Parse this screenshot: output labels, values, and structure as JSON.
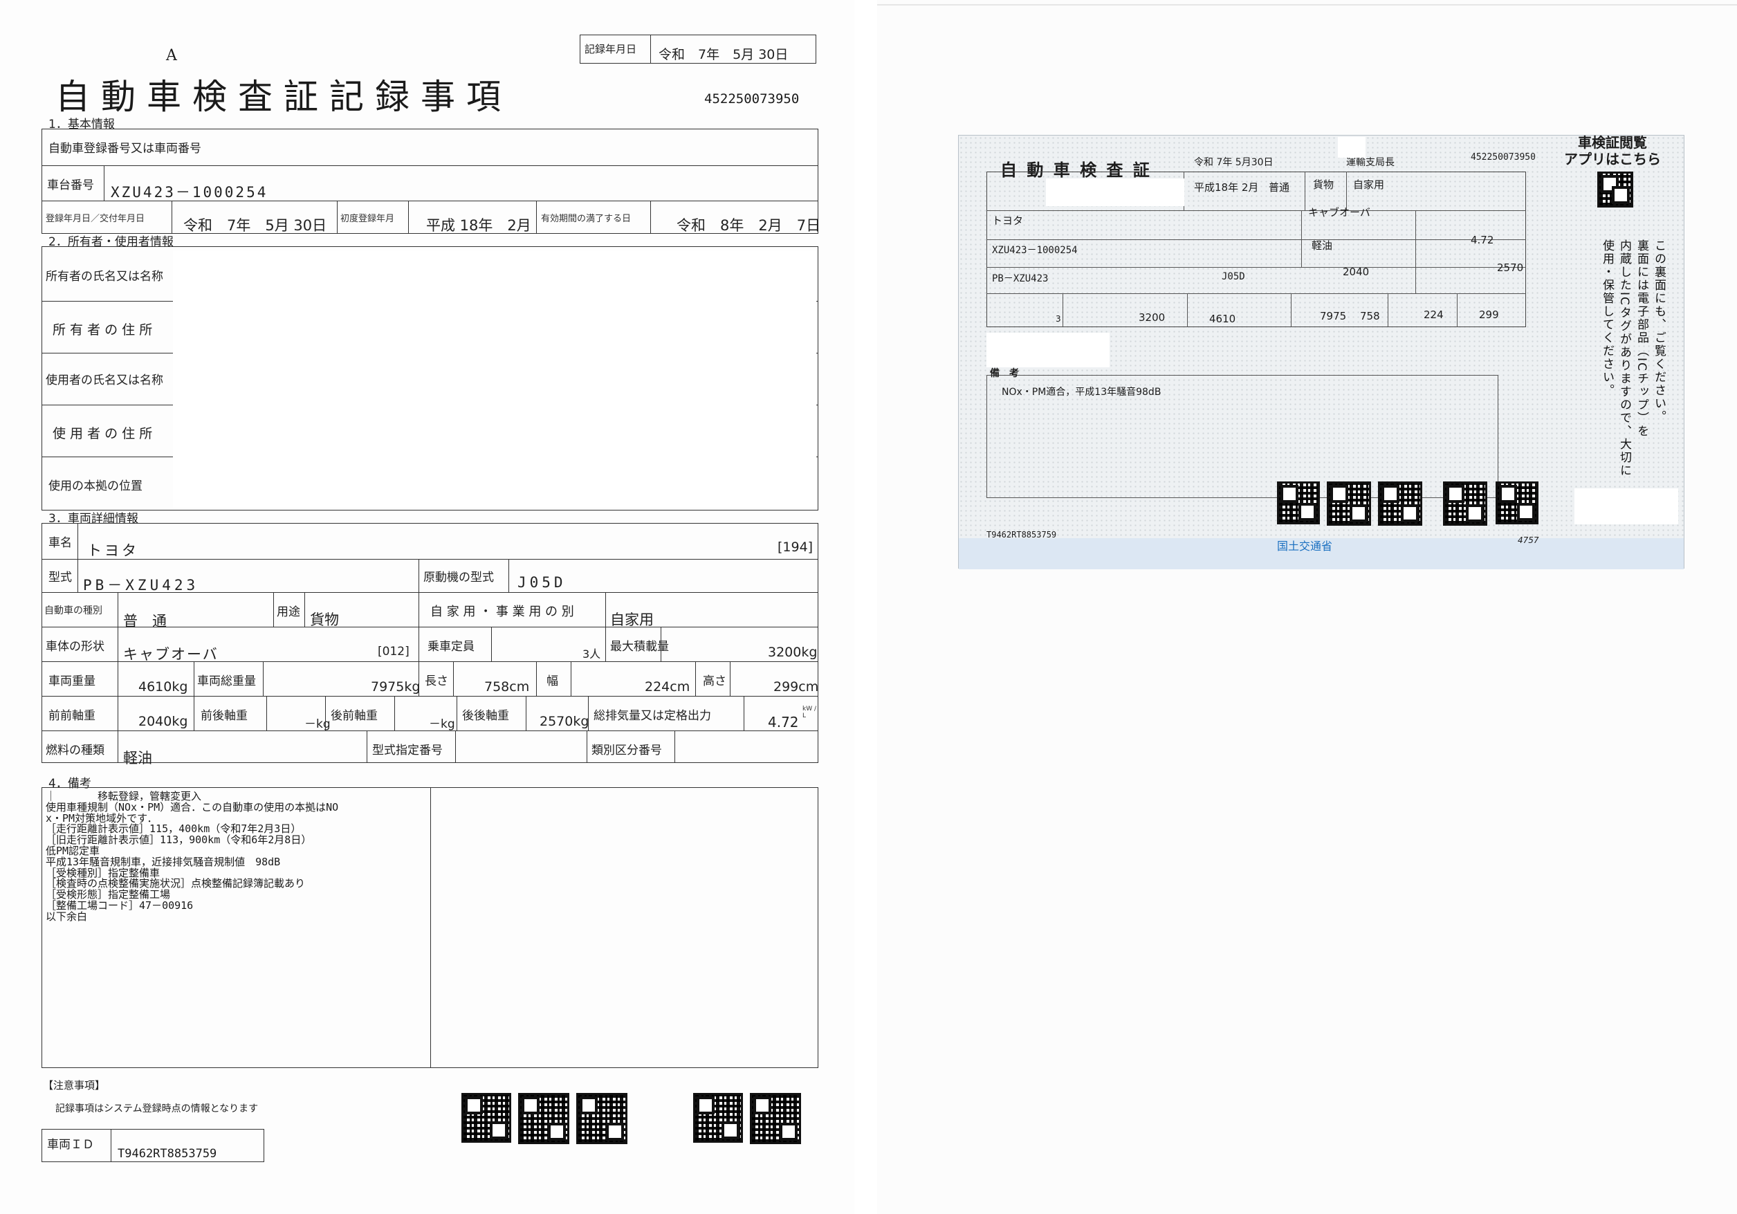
{
  "left": {
    "page_marker": "A",
    "title": "自動車検査証記録事項",
    "record_date_label": "記録年月日",
    "record_date": "令和　7年　5月 30日",
    "doc_number": "452250073950",
    "sections": {
      "basic": "1．基本情報",
      "owner": "2．所有者・使用者情報",
      "vehicle": "3．車両詳細情報",
      "remarks": "4．備考"
    },
    "basic": {
      "reg_label": "自動車登録番号又は車両番号",
      "chassis_label": "車台番号",
      "chassis": "XZU423－1000254",
      "reg_date_label": "登録年月日／交付年月日",
      "reg_date": "令和　7年　5月 30日",
      "first_reg_label": "初度登録年月",
      "first_reg": "平成 18年　2月",
      "expiry_label": "有効期間の満了する日",
      "expiry": "令和　8年　2月　7日"
    },
    "owner": {
      "owner_name": "所有者の氏名又は名称",
      "owner_address": "所 有 者 の 住 所",
      "user_name": "使用者の氏名又は名称",
      "user_address": "使 用 者 の 住 所",
      "base_location": "使用の本拠の位置"
    },
    "vehicle": {
      "name_label": "車名",
      "name": "トヨタ",
      "name_code": "[194]",
      "model_label": "型式",
      "model": "PB－XZU423",
      "engine_label": "原動機の型式",
      "engine": "J05D",
      "kind_label": "自動車の種別",
      "kind": "普　通",
      "use_label": "用途",
      "use": "貨物",
      "private_label": "自 家 用 ・ 事 業 用 の 別",
      "private": "自家用",
      "body_label": "車体の形状",
      "body": "キャブオーバ",
      "body_code": "[012]",
      "capacity_label": "乗車定員",
      "capacity": "3人",
      "max_load_label": "最大積載量",
      "max_load": "3200kg",
      "weight_label": "車両重量",
      "weight": "4610kg",
      "gross_label": "車両総重量",
      "gross": "7975kg",
      "length_label": "長さ",
      "length": "758cm",
      "width_label": "幅",
      "width": "224cm",
      "height_label": "高さ",
      "height": "299cm",
      "ff_label": "前前軸重",
      "ff": "2040kg",
      "fr_label": "前後軸重",
      "fr": "－kg",
      "rf_label": "後前軸重",
      "rf": "－kg",
      "rr_label": "後後軸重",
      "rr": "2570kg",
      "disp_label": "総排気量又は定格出力",
      "disp": "4.72",
      "disp_unit": "kW / L",
      "fuel_label": "燃料の種類",
      "fuel": "軽油",
      "type_no_label": "型式指定番号",
      "class_no_label": "類別区分番号"
    },
    "remarks": [
      "｜　　　　移転登録，管轄変更入",
      "使用車種規制（NOx・PM）適合．この自動車の使用の本拠はNO",
      "x・PM対策地域外です．",
      "［走行距離計表示値］115，400km（令和7年2月3日）",
      "［旧走行距離計表示値］113，900km（令和6年2月8日）",
      "低PM認定車",
      "平成13年騒音規制車，近接排気騒音規制値　98dB",
      "［受検種別］指定整備車",
      "［検査時の点検整備実施状況］点検整備記録簿記載あり",
      "［受検形態］指定整備工場",
      "［整備工場コード］47－00916",
      "以下余白"
    ],
    "notice_title": "【注意事項】",
    "notice_text": "記録事項はシステム登録時点の情報となります",
    "vehicle_id_label": "車両ＩＤ",
    "vehicle_id": "T9462RT8853759"
  },
  "card": {
    "title": "自 動 車 検 査 証",
    "date": "令和 7年 5月30日",
    "issuer": "運輸支局長",
    "doc_number": "452250073950",
    "app_title": "車検証閲覧\nアプリはこちら",
    "first_reg": "平成18年 2月",
    "kind": "普通",
    "use": "貨物",
    "private": "自家用",
    "name": "トヨタ",
    "body": "キャブオーバ",
    "chassis": "XZU423－1000254",
    "fuel": "軽油",
    "disp": "4.72",
    "model": "PB－XZU423",
    "engine": "J05D",
    "ff": "2040",
    "rr": "2570",
    "capacity": "3",
    "max_load": "3200",
    "weight": "4610",
    "gross": "7975",
    "length": "758",
    "width": "224",
    "height": "299",
    "remarks_label": "備　考",
    "remarks": "NOx・PM適合，平成13年騒音98dB",
    "vertical_text_1": "この裏面にも、ご覧ください。",
    "vertical_text_2": "内蔵したICタグがありますので、大切に",
    "vertical_text_3": "使用・保管してください。",
    "vertical_text_4": "裏面には電子部品（ICチップ）を",
    "vehicle_id": "T9462RT8853759",
    "ministry": "国土交通省",
    "serial": "4757"
  }
}
